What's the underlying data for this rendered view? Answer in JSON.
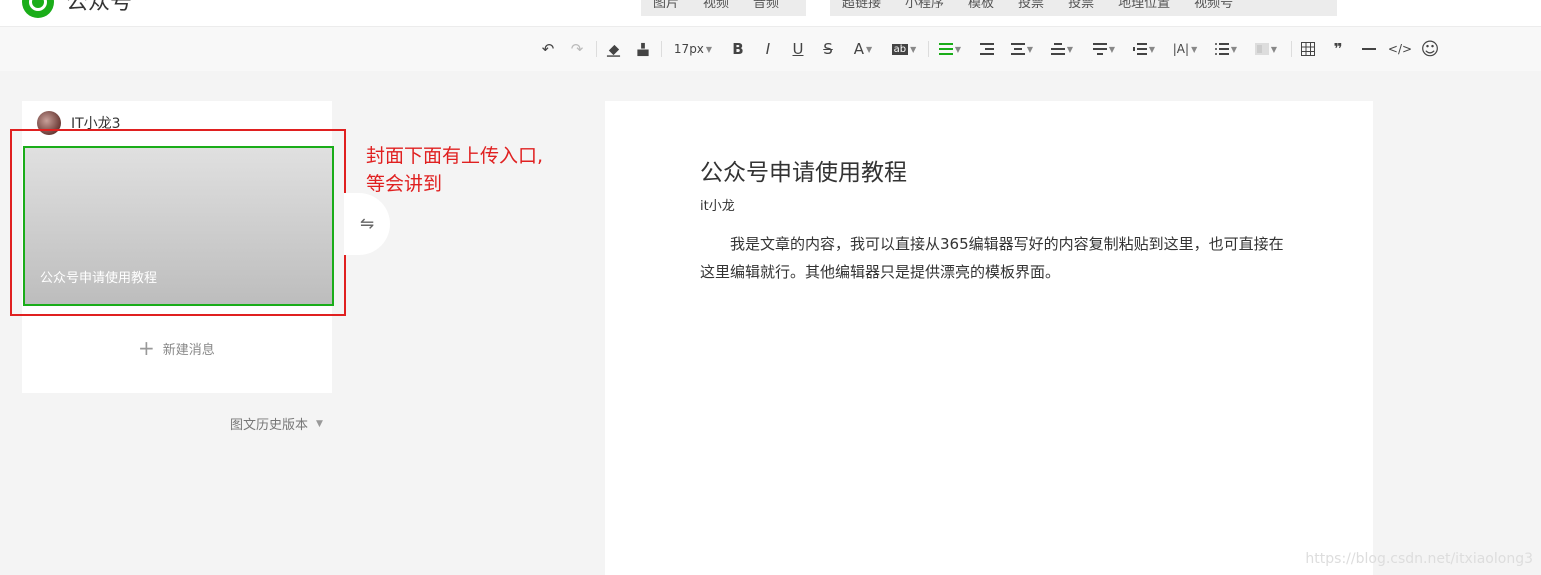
{
  "app": {
    "title": "公众号"
  },
  "insert_menu": {
    "group1": [
      "图片",
      "视频",
      "音频"
    ],
    "group2": [
      "超链接",
      "小程序",
      "模板",
      "投票",
      "投票",
      "地理位置",
      "视频号"
    ]
  },
  "toolbar": {
    "undo": "↶",
    "redo": "↷",
    "font_size": "17px",
    "bold": "B",
    "italic": "I",
    "underline": "U",
    "strike": "S",
    "font_color": "A",
    "highlight": "ab",
    "quote": "❞",
    "emoji": "☺"
  },
  "sidebar": {
    "account_name": "IT小龙3",
    "cover_title": "公众号申请使用教程",
    "new_message": "新建消息",
    "history": "图文历史版本"
  },
  "annotation": {
    "line1": "封面下面有上传入口,",
    "line2": "等会讲到"
  },
  "article": {
    "title": "公众号申请使用教程",
    "author": "it小龙",
    "body": "我是文章的内容，我可以直接从365编辑器写好的内容复制粘贴到这里，也可直接在这里编辑就行。其他编辑器只是提供漂亮的模板界面。"
  },
  "watermark": "https://blog.csdn.net/itxiaolong3",
  "colors": {
    "accent": "#1aad19",
    "annotation": "#e02020"
  }
}
